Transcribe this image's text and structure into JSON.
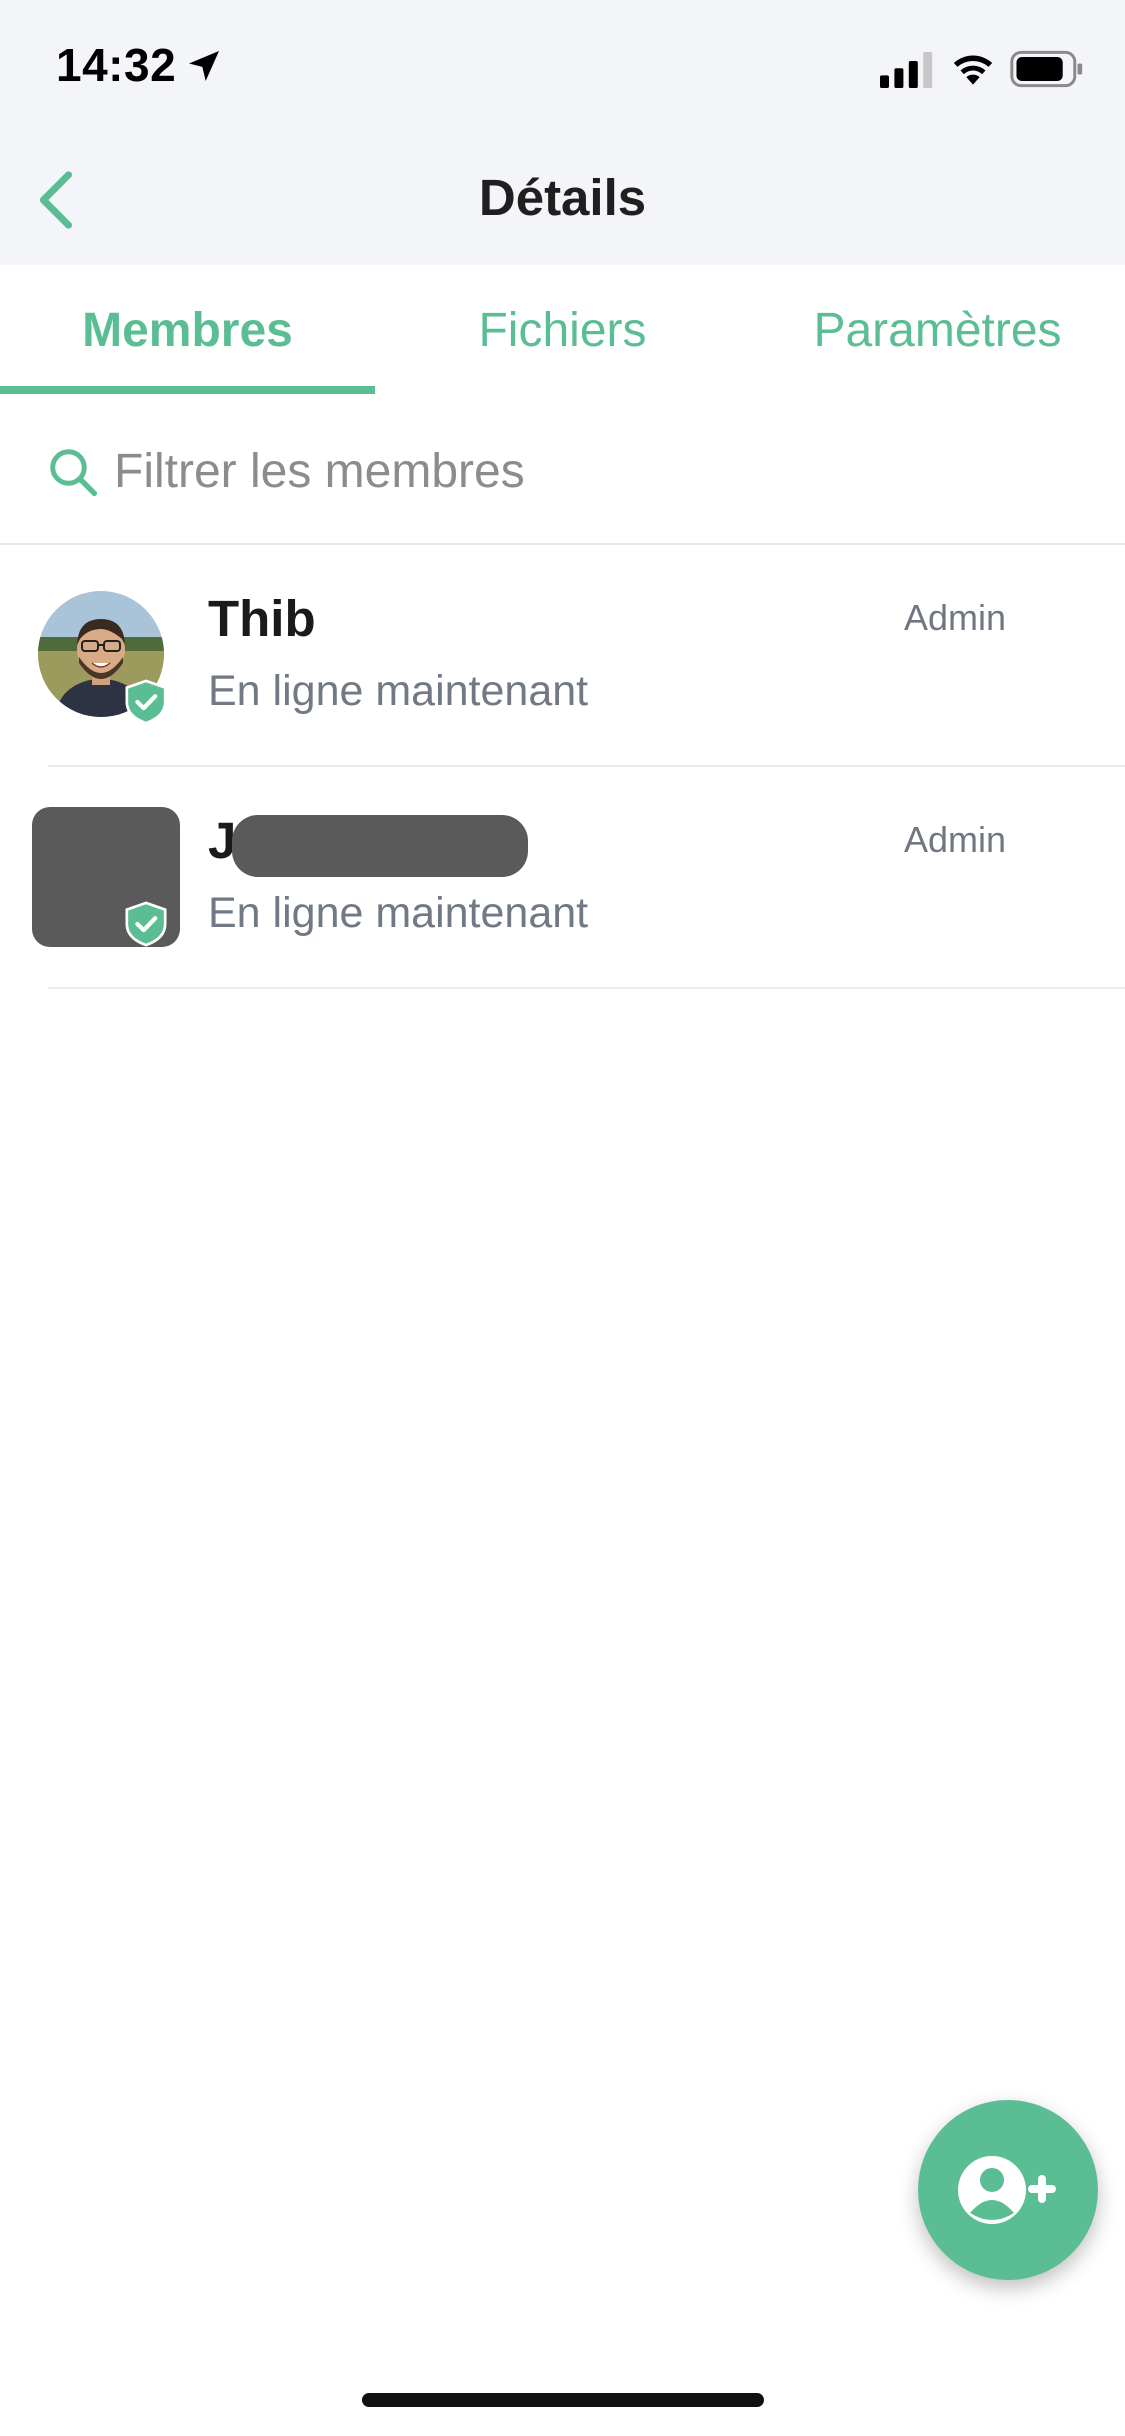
{
  "status_bar": {
    "time": "14:32"
  },
  "header": {
    "title": "Détails"
  },
  "tabs": [
    {
      "label": "Membres",
      "active": true
    },
    {
      "label": "Fichiers",
      "active": false
    },
    {
      "label": "Paramètres",
      "active": false
    }
  ],
  "search": {
    "placeholder": "Filtrer les membres",
    "value": ""
  },
  "members": [
    {
      "name": "Thib",
      "status": "En ligne maintenant",
      "role": "Admin",
      "verified": true
    },
    {
      "name": "J",
      "status": "En ligne maintenant",
      "role": "Admin",
      "verified": true
    }
  ],
  "colors": {
    "accent": "#5bbd93",
    "header_bg": "#f4f5f9"
  },
  "icons": {
    "back": "chevron-left-icon",
    "search": "search-icon",
    "badge": "shield-check-icon",
    "fab": "add-user-icon"
  }
}
